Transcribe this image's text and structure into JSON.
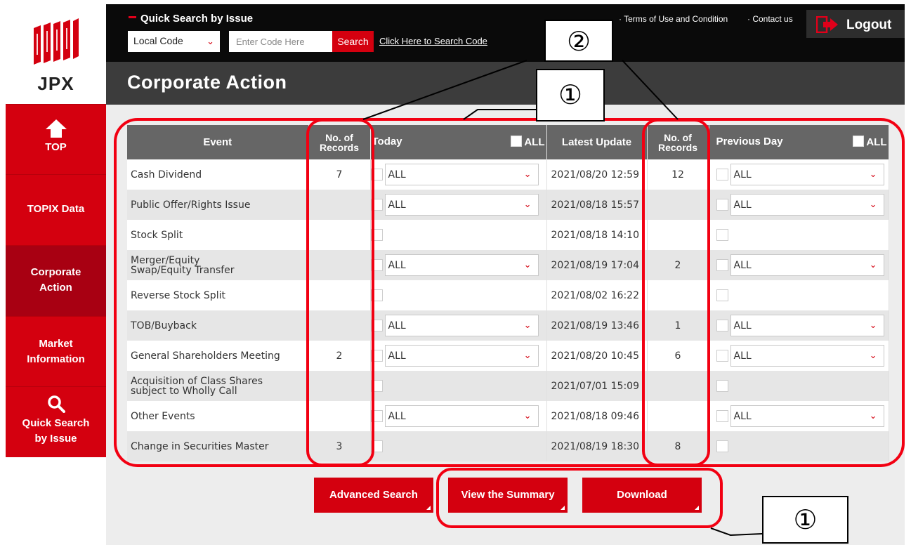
{
  "logo": {
    "text": "JPX"
  },
  "sidebar": {
    "items": [
      {
        "label": "TOP",
        "icon": "home-icon"
      },
      {
        "label": "TOPIX Data"
      },
      {
        "label": "Corporate",
        "label2": "Action"
      },
      {
        "label": "Market",
        "label2": "Information"
      },
      {
        "label": "Quick Search",
        "label2": "by Issue",
        "icon": "search-icon"
      }
    ]
  },
  "topbar": {
    "quick_search_title": "Quick Search by Issue",
    "code_type": "Local Code",
    "code_placeholder": "Enter Code Here",
    "search_label": "Search",
    "search_link": "Click Here to Search Code",
    "terms": "· Terms of Use and Condition",
    "contact": "· Contact us",
    "logout": "Logout"
  },
  "page_title": "Corporate Action",
  "table": {
    "headers": {
      "event": "Event",
      "records_line1": "No. of",
      "records_line2": "Records",
      "today": "Today",
      "all": "ALL",
      "latest_update": "Latest Update",
      "previous_day": "Previous Day"
    },
    "rows": [
      {
        "event": "Cash Dividend",
        "today_records": "7",
        "today_select": "ALL",
        "latest_update": "2021/08/20 12:59",
        "prev_records": "12",
        "prev_select": "ALL"
      },
      {
        "event": "Public Offer/Rights Issue",
        "today_records": "",
        "today_select": "ALL",
        "latest_update": "2021/08/18 15:57",
        "prev_records": "",
        "prev_select": "ALL"
      },
      {
        "event": "Stock Split",
        "today_records": "",
        "today_select": "",
        "latest_update": "2021/08/18 14:10",
        "prev_records": "",
        "prev_select": ""
      },
      {
        "event": "Merger/Equity",
        "event2": "Swap/Equity Transfer",
        "today_records": "",
        "today_select": "ALL",
        "latest_update": "2021/08/19 17:04",
        "prev_records": "2",
        "prev_select": "ALL"
      },
      {
        "event": "Reverse Stock Split",
        "today_records": "",
        "today_select": "",
        "latest_update": "2021/08/02 16:22",
        "prev_records": "",
        "prev_select": ""
      },
      {
        "event": "TOB/Buyback",
        "today_records": "",
        "today_select": "ALL",
        "latest_update": "2021/08/19 13:46",
        "prev_records": "1",
        "prev_select": "ALL"
      },
      {
        "event": "General Shareholders Meeting",
        "today_records": "2",
        "today_select": "ALL",
        "latest_update": "2021/08/20 10:45",
        "prev_records": "6",
        "prev_select": "ALL"
      },
      {
        "event": "Acquisition of Class Shares",
        "event2": "subject to Wholly Call",
        "today_records": "",
        "today_select": "",
        "latest_update": "2021/07/01 15:09",
        "prev_records": "",
        "prev_select": ""
      },
      {
        "event": "Other Events",
        "today_records": "",
        "today_select": "ALL",
        "latest_update": "2021/08/18 09:46",
        "prev_records": "",
        "prev_select": "ALL"
      },
      {
        "event": "Change in Securities Master",
        "today_records": "3",
        "today_select": "",
        "latest_update": "2021/08/19 18:30",
        "prev_records": "8",
        "prev_select": ""
      }
    ]
  },
  "buttons": {
    "advanced_search": "Advanced Search",
    "view_summary": "View the Summary",
    "download": "Download"
  },
  "annotations": {
    "callout_2": "②",
    "callout_1a": "①",
    "callout_1b": "①",
    "highlight_color": "#f20012"
  },
  "colors": {
    "brand_red": "#d4000f",
    "topbar": "#0a0a0a",
    "titlebar": "#3c3c3c",
    "header_gray": "#666666"
  }
}
